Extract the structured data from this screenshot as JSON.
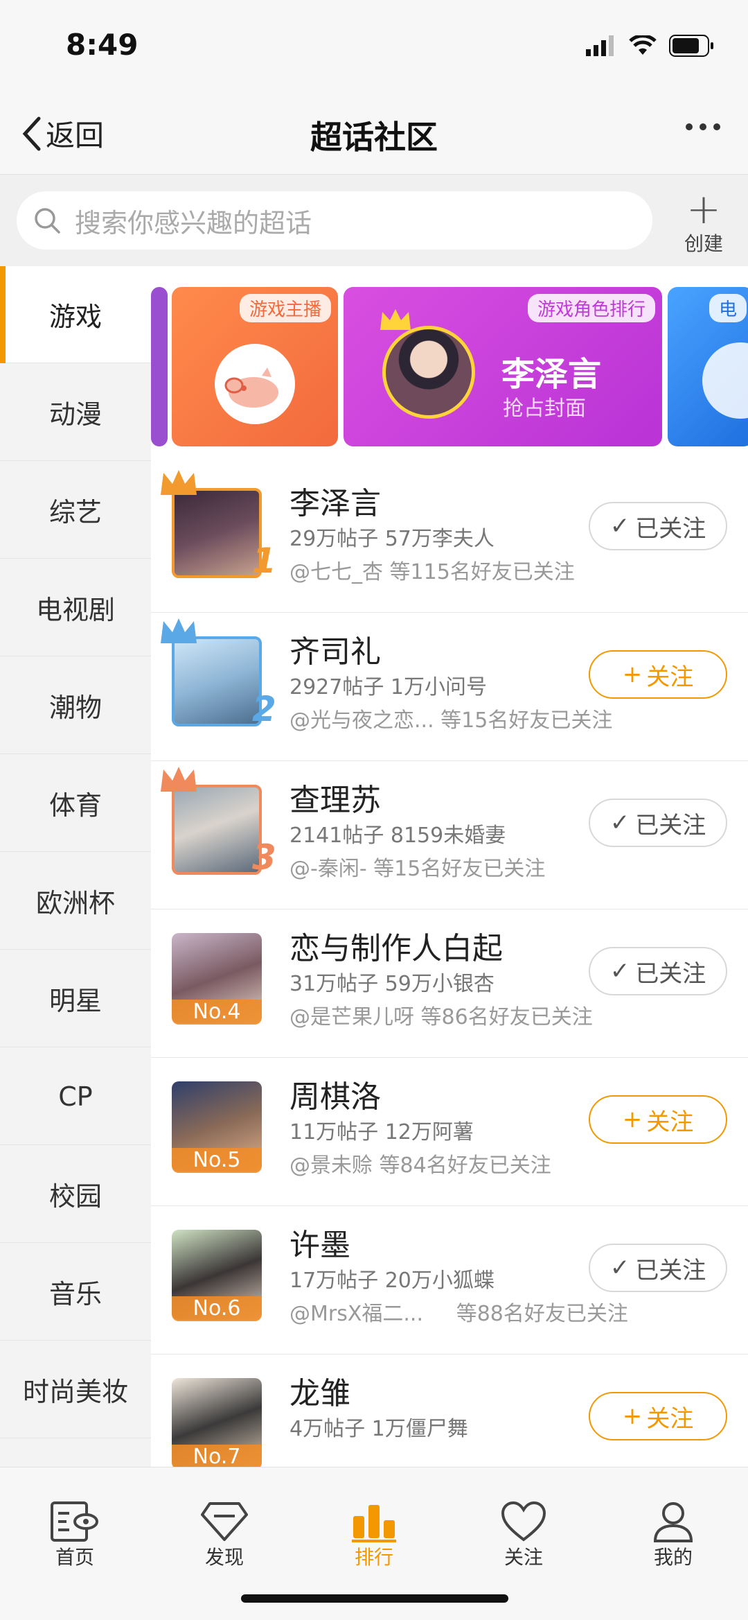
{
  "status": {
    "time": "8:49"
  },
  "nav": {
    "back_label": "返回",
    "title": "超话社区"
  },
  "search": {
    "placeholder": "搜索你感兴趣的超话",
    "create_label": "创建"
  },
  "sidebar": [
    {
      "label": "游戏",
      "active": true
    },
    {
      "label": "动漫"
    },
    {
      "label": "综艺"
    },
    {
      "label": "电视剧"
    },
    {
      "label": "潮物"
    },
    {
      "label": "体育"
    },
    {
      "label": "欧洲杯"
    },
    {
      "label": "明星"
    },
    {
      "label": "CP"
    },
    {
      "label": "校园"
    },
    {
      "label": "音乐"
    },
    {
      "label": "时尚美妆"
    }
  ],
  "banners": [
    {
      "tag": "游戏主播"
    },
    {
      "tag": "游戏角色排行",
      "title": "李泽言",
      "subtitle": "抢占封面"
    },
    {
      "tag": "电"
    }
  ],
  "rows": [
    {
      "rank": "1",
      "name": "李泽言",
      "stats": "29万帖子 57万李夫人",
      "friends": "@七七_杏 等115名好友已关注",
      "button": "已关注",
      "followed": true,
      "color": "#f39a2e"
    },
    {
      "rank": "2",
      "name": "齐司礼",
      "stats": "2927帖子 1万小问号",
      "friends": "@光与夜之恋... 等15名好友已关注",
      "button": "关注",
      "followed": false,
      "color": "#5aa9e6"
    },
    {
      "rank": "3",
      "name": "查理苏",
      "stats": "2141帖子 8159未婚妻",
      "friends": "@-秦闲- 等15名好友已关注",
      "button": "已关注",
      "followed": true,
      "color": "#f08a5d"
    },
    {
      "rank": "No.4",
      "name": "恋与制作人白起",
      "stats": "31万帖子 59万小银杏",
      "friends": "@是芒果儿呀 等86名好友已关注",
      "button": "已关注",
      "followed": true
    },
    {
      "rank": "No.5",
      "name": "周棋洛",
      "stats": "11万帖子 12万阿薯",
      "friends": "@景未赊 等84名好友已关注",
      "button": "关注",
      "followed": false
    },
    {
      "rank": "No.6",
      "name": "许墨",
      "stats": "17万帖子 20万小狐蝶",
      "friends": "@MrsX福二...     等88名好友已关注",
      "button": "已关注",
      "followed": true
    },
    {
      "rank": "No.7",
      "name": "龙雏",
      "stats": "4万帖子 1万僵尸舞",
      "friends": "",
      "button": "关注",
      "followed": false
    }
  ],
  "tabs": [
    {
      "label": "首页",
      "icon": "home-icon"
    },
    {
      "label": "发现",
      "icon": "diamond-icon"
    },
    {
      "label": "排行",
      "icon": "rank-bars-icon",
      "active": true
    },
    {
      "label": "关注",
      "icon": "heart-icon"
    },
    {
      "label": "我的",
      "icon": "person-icon"
    }
  ],
  "colors": {
    "accent": "#f39800"
  }
}
